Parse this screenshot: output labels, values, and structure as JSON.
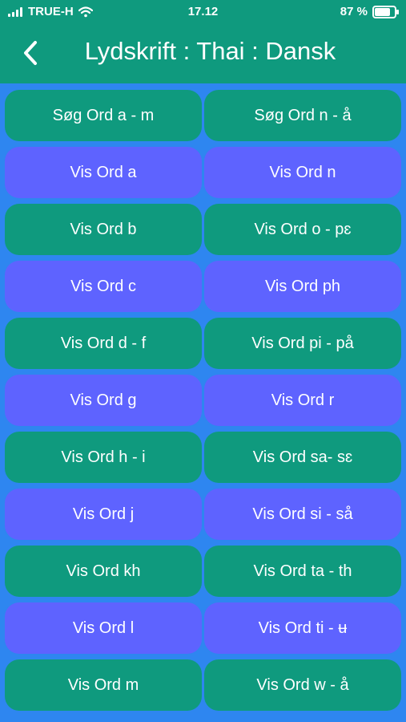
{
  "status_bar": {
    "carrier": "TRUE-H",
    "time": "17.12",
    "battery_percent": "87 %",
    "battery_level": 0.87
  },
  "header": {
    "title": "Lydskrift : Thai : Dansk",
    "back_icon": "chevron-left-icon"
  },
  "colors": {
    "header": "#0f9a7e",
    "background": "#2e86f0",
    "green_button": "#0f9a7e",
    "purple_button": "#5e63ff"
  },
  "buttons": [
    {
      "label": "Søg Ord a - m",
      "color": "green"
    },
    {
      "label": "Søg Ord n - å",
      "color": "green"
    },
    {
      "label": "Vis Ord a",
      "color": "purple"
    },
    {
      "label": "Vis Ord n",
      "color": "purple"
    },
    {
      "label": "Vis Ord b",
      "color": "green"
    },
    {
      "label": "Vis Ord o - pɛ",
      "color": "green"
    },
    {
      "label": "Vis Ord c",
      "color": "purple"
    },
    {
      "label": "Vis Ord ph",
      "color": "purple"
    },
    {
      "label": "Vis Ord d - f",
      "color": "green"
    },
    {
      "label": "Vis Ord pi - på",
      "color": "green"
    },
    {
      "label": "Vis Ord g",
      "color": "purple"
    },
    {
      "label": "Vis Ord r",
      "color": "purple"
    },
    {
      "label": "Vis Ord h - i",
      "color": "green"
    },
    {
      "label": "Vis Ord sa- sɛ",
      "color": "green"
    },
    {
      "label": "Vis Ord j",
      "color": "purple"
    },
    {
      "label": "Vis Ord si - så",
      "color": "purple"
    },
    {
      "label": "Vis Ord kh",
      "color": "green"
    },
    {
      "label": "Vis Ord ta - th",
      "color": "green"
    },
    {
      "label": "Vis Ord l",
      "color": "purple"
    },
    {
      "label": "Vis Ord ti - ʉ",
      "color": "purple"
    },
    {
      "label": "Vis Ord m",
      "color": "green"
    },
    {
      "label": "Vis Ord w - å",
      "color": "green"
    }
  ]
}
